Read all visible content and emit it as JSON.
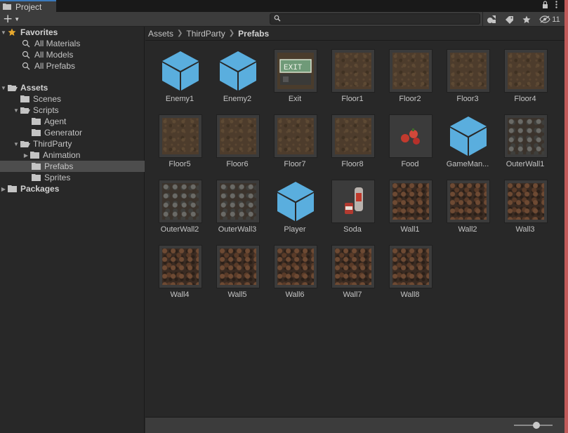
{
  "window": {
    "tab_title": "Project"
  },
  "toolbar": {
    "hidden_count": "11"
  },
  "tree": {
    "favorites": {
      "label": "Favorites",
      "items": [
        "All Materials",
        "All Models",
        "All Prefabs"
      ]
    },
    "assets": "Assets",
    "scenes": "Scenes",
    "scripts": "Scripts",
    "agent": "Agent",
    "generator": "Generator",
    "third_party": "ThirdParty",
    "animation": "Animation",
    "prefabs": "Prefabs",
    "sprites": "Sprites",
    "packages": "Packages"
  },
  "breadcrumb": [
    "Assets",
    "ThirdParty",
    "Prefabs"
  ],
  "assets_grid": [
    {
      "name": "Enemy1",
      "kind": "prefab-cube"
    },
    {
      "name": "Enemy2",
      "kind": "prefab-cube"
    },
    {
      "name": "Exit",
      "kind": "sprite-exit"
    },
    {
      "name": "Floor1",
      "kind": "sprite-floor"
    },
    {
      "name": "Floor2",
      "kind": "sprite-floor"
    },
    {
      "name": "Floor3",
      "kind": "sprite-floor"
    },
    {
      "name": "Floor4",
      "kind": "sprite-floor"
    },
    {
      "name": "Floor5",
      "kind": "sprite-floor"
    },
    {
      "name": "Floor6",
      "kind": "sprite-floor"
    },
    {
      "name": "Floor7",
      "kind": "sprite-floor"
    },
    {
      "name": "Floor8",
      "kind": "sprite-floor"
    },
    {
      "name": "Food",
      "kind": "sprite-food"
    },
    {
      "name": "GameMan...",
      "kind": "prefab-cube"
    },
    {
      "name": "OuterWall1",
      "kind": "sprite-outer"
    },
    {
      "name": "OuterWall2",
      "kind": "sprite-outer"
    },
    {
      "name": "OuterWall3",
      "kind": "sprite-outer"
    },
    {
      "name": "Player",
      "kind": "prefab-cube"
    },
    {
      "name": "Soda",
      "kind": "sprite-soda"
    },
    {
      "name": "Wall1",
      "kind": "sprite-wall"
    },
    {
      "name": "Wall2",
      "kind": "sprite-wall"
    },
    {
      "name": "Wall3",
      "kind": "sprite-wall"
    },
    {
      "name": "Wall4",
      "kind": "sprite-wall"
    },
    {
      "name": "Wall5",
      "kind": "sprite-wall"
    },
    {
      "name": "Wall6",
      "kind": "sprite-wall"
    },
    {
      "name": "Wall7",
      "kind": "sprite-wall"
    },
    {
      "name": "Wall8",
      "kind": "sprite-wall"
    }
  ],
  "colors": {
    "selection": "#4d4d4d",
    "prefab_blue": "#5aaede",
    "tab_accent": "#3a79bb",
    "favorite_star": "#e6a82e"
  },
  "icons": {
    "tab": "folder-icon",
    "create": "plus-icon",
    "search": "search-icon",
    "type_filter": "shapes-icon",
    "label_filter": "tag-icon",
    "favorite": "star-icon",
    "visibility": "eye-slash-icon",
    "lock": "lock-icon",
    "menu": "kebab-menu-icon"
  }
}
